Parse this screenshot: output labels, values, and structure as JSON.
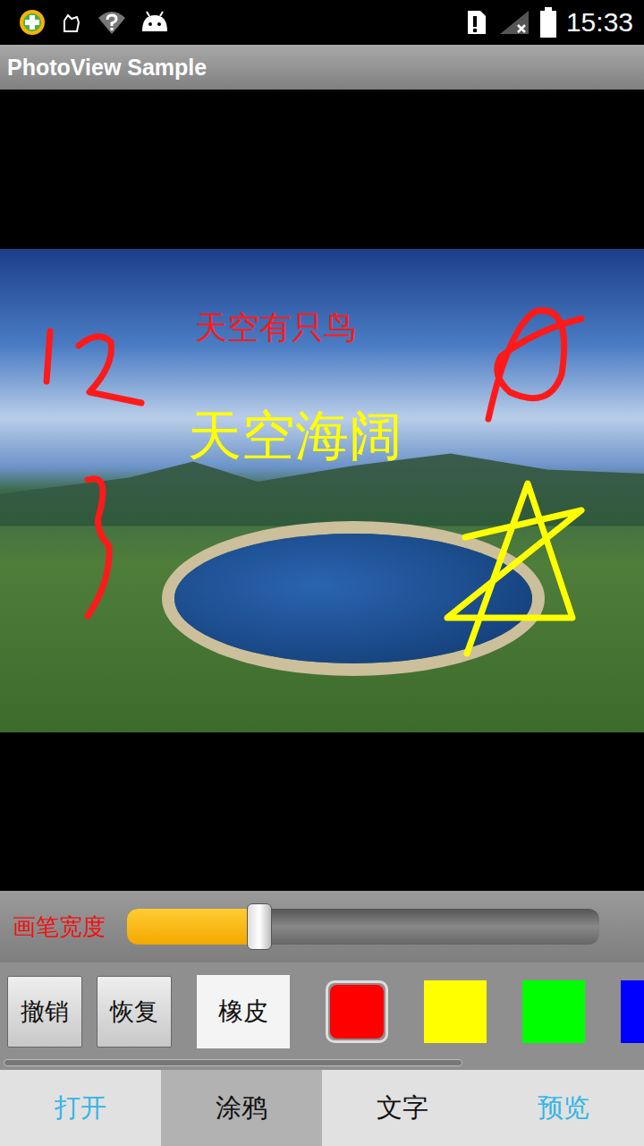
{
  "status_bar": {
    "time": "15:33"
  },
  "window": {
    "title": "PhotoView Sample"
  },
  "canvas": {
    "annotations": [
      {
        "text": "天空有只鸟",
        "color": "#ff1a1a"
      },
      {
        "text": "天空海阔",
        "color": "#ffff00"
      }
    ]
  },
  "brush": {
    "label": "画笔宽度",
    "level": 0.28
  },
  "tools": {
    "buttons": [
      "撤销",
      "恢复"
    ],
    "eraser": {
      "label": "橡皮",
      "selected": false
    },
    "colors": [
      {
        "color": "#ff0000",
        "selected": true
      },
      {
        "color": "#ffff00",
        "selected": false
      },
      {
        "color": "#00ff00",
        "selected": false
      },
      {
        "color": "#0000ff",
        "selected": false
      }
    ],
    "scroll_level": 0.71
  },
  "tabs": [
    {
      "label": "打开",
      "selected": false,
      "color": "#33b5e5"
    },
    {
      "label": "涂鸦",
      "selected": true,
      "color": "#111111"
    },
    {
      "label": "文字",
      "selected": false,
      "color": "#111111"
    },
    {
      "label": "预览",
      "selected": false,
      "color": "#33b5e5"
    }
  ]
}
